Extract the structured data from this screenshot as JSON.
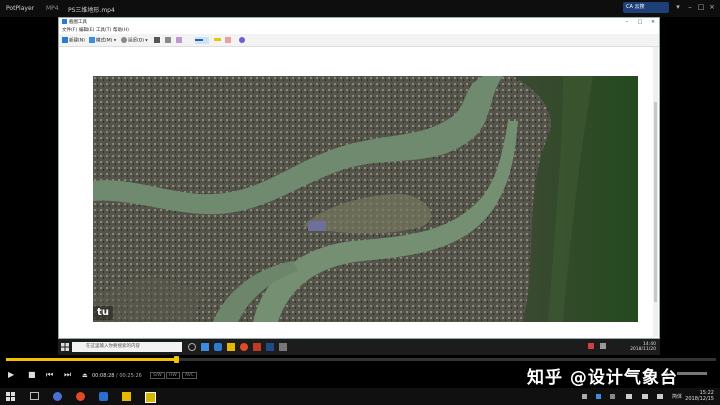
{
  "player": {
    "brand": "PotPlayer",
    "mode": "MP4",
    "file_title": "PS三维地形.mp4",
    "cloud_label": "CA 云搜",
    "current_time": "00:08:28",
    "total_time": "00:25:26",
    "tags": [
      "S/W",
      "HW",
      "AVC"
    ],
    "progress_fraction": 0.24,
    "accent_color": "#f2c200"
  },
  "snipping_tool": {
    "title": "截图工具",
    "menu": [
      "文件(F)",
      "编辑(E)",
      "工具(T)",
      "帮助(H)"
    ],
    "toolbar": {
      "new_label": "新建(N)",
      "mode_label": "模式(M)",
      "delay_label": "延迟(D)"
    },
    "image_watermark": "tu"
  },
  "inner_taskbar": {
    "search_placeholder": "在这里输入你要搜索的内容",
    "clock_time": "14:40",
    "clock_date": "2018/11/20"
  },
  "overlay": {
    "zhihu_watermark": "知乎 @设计气象台"
  },
  "outer_taskbar": {
    "lang": "简体",
    "clock_time": "15:22",
    "clock_date": "2018/12/15"
  },
  "colors": {
    "river": "#6f8a6e",
    "city": "#4a4a40",
    "forest": "#2f4a26"
  }
}
